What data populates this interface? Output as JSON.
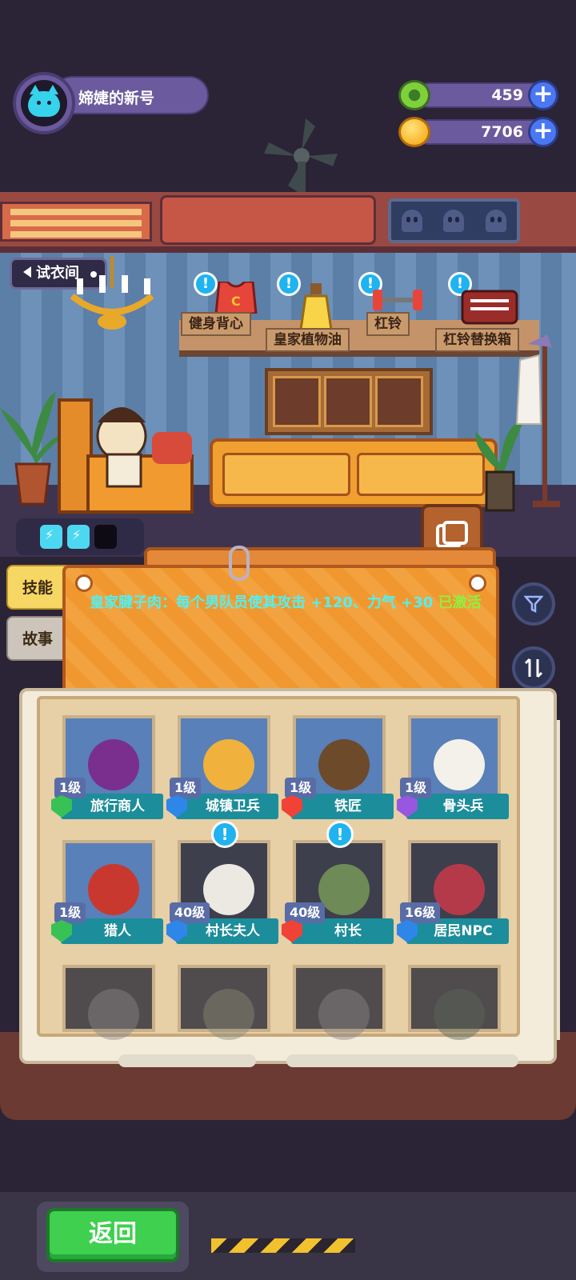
{
  "player": {
    "name": "媂婕的新号",
    "avatar_icon": "cat-face-icon"
  },
  "currencies": [
    {
      "name": "gem",
      "value": "459",
      "icon": "green-gem-icon"
    },
    {
      "name": "coin",
      "value": "7706",
      "icon": "gold-planet-coin-icon"
    }
  ],
  "scene": {
    "fitting_room_label": "试衣间",
    "items": [
      {
        "label": "健身背心",
        "icon": "tank-top-icon",
        "alert": "!"
      },
      {
        "label": "皇家植物油",
        "icon": "oil-bottle-icon",
        "alert": "!"
      },
      {
        "label": "杠铃",
        "icon": "barbell-icon",
        "alert": "!"
      },
      {
        "label": "杠铃替换箱",
        "icon": "barbell-box-icon",
        "alert": "!"
      }
    ],
    "energy": {
      "filled": 2,
      "total": 3
    }
  },
  "info_board": {
    "tabs": [
      {
        "label": "技能",
        "active": true
      },
      {
        "label": "故事",
        "active": false
      }
    ],
    "skill_text": "皇家腱子肉：每个男队员使其攻击 +120、力气 +30",
    "skill_status": "已激活"
  },
  "roster": [
    {
      "level": "1级",
      "name": "旅行商人",
      "rank": "green",
      "alert": false,
      "locked": false
    },
    {
      "level": "1级",
      "name": "城镇卫兵",
      "rank": "blue",
      "alert": false,
      "locked": false
    },
    {
      "level": "1级",
      "name": "铁匠",
      "rank": "red",
      "alert": false,
      "locked": false
    },
    {
      "level": "1级",
      "name": "骨头兵",
      "rank": "purple",
      "alert": false,
      "locked": false
    },
    {
      "level": "1级",
      "name": "猎人",
      "rank": "green",
      "alert": false,
      "locked": false
    },
    {
      "level": "40级",
      "name": "村长夫人",
      "rank": "blue",
      "alert": true,
      "locked": false
    },
    {
      "level": "40级",
      "name": "村长",
      "rank": "red",
      "alert": true,
      "locked": false
    },
    {
      "level": "16级",
      "name": "居民NPC",
      "rank": "blue",
      "alert": false,
      "locked": false
    },
    {
      "level": "",
      "name": "",
      "rank": "",
      "alert": false,
      "locked": true
    },
    {
      "level": "",
      "name": "",
      "rank": "",
      "alert": false,
      "locked": true
    },
    {
      "level": "",
      "name": "",
      "rank": "",
      "alert": false,
      "locked": true
    },
    {
      "level": "",
      "name": "",
      "rank": "",
      "alert": false,
      "locked": true
    }
  ],
  "footer": {
    "back_label": "返回"
  },
  "colors": {
    "accent_cyan": "#51f1f2",
    "active_green": "#8ef13d",
    "name_bar_teal": "#1c8d9a",
    "back_button_green": "#3ed04e"
  }
}
